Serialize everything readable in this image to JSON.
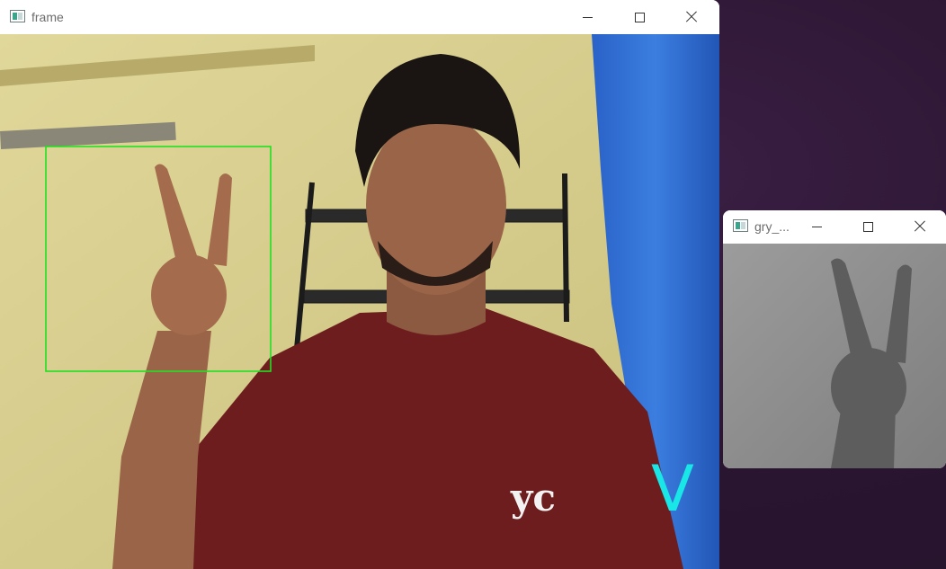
{
  "windows": {
    "frame": {
      "title": "frame",
      "icon": "opencv-window-icon",
      "controls": [
        "minimize-icon",
        "maximize-icon",
        "close-icon"
      ]
    },
    "gray": {
      "title": "gry_...",
      "icon": "opencv-window-icon",
      "controls": [
        "minimize-icon",
        "maximize-icon",
        "close-icon"
      ]
    }
  },
  "overlay": {
    "roi_box_color": "#22e022",
    "predicted_letter": "V",
    "predicted_letter_color": "#19e6e6"
  },
  "colors": {
    "titlebar": "#ffffff",
    "desktop": "#2a1530",
    "wall": "#d6cd8e",
    "curtain": "#2f6fd1",
    "shirt": "#6e1d1f"
  },
  "camera_feed": {
    "shirt_logo": "yc"
  }
}
